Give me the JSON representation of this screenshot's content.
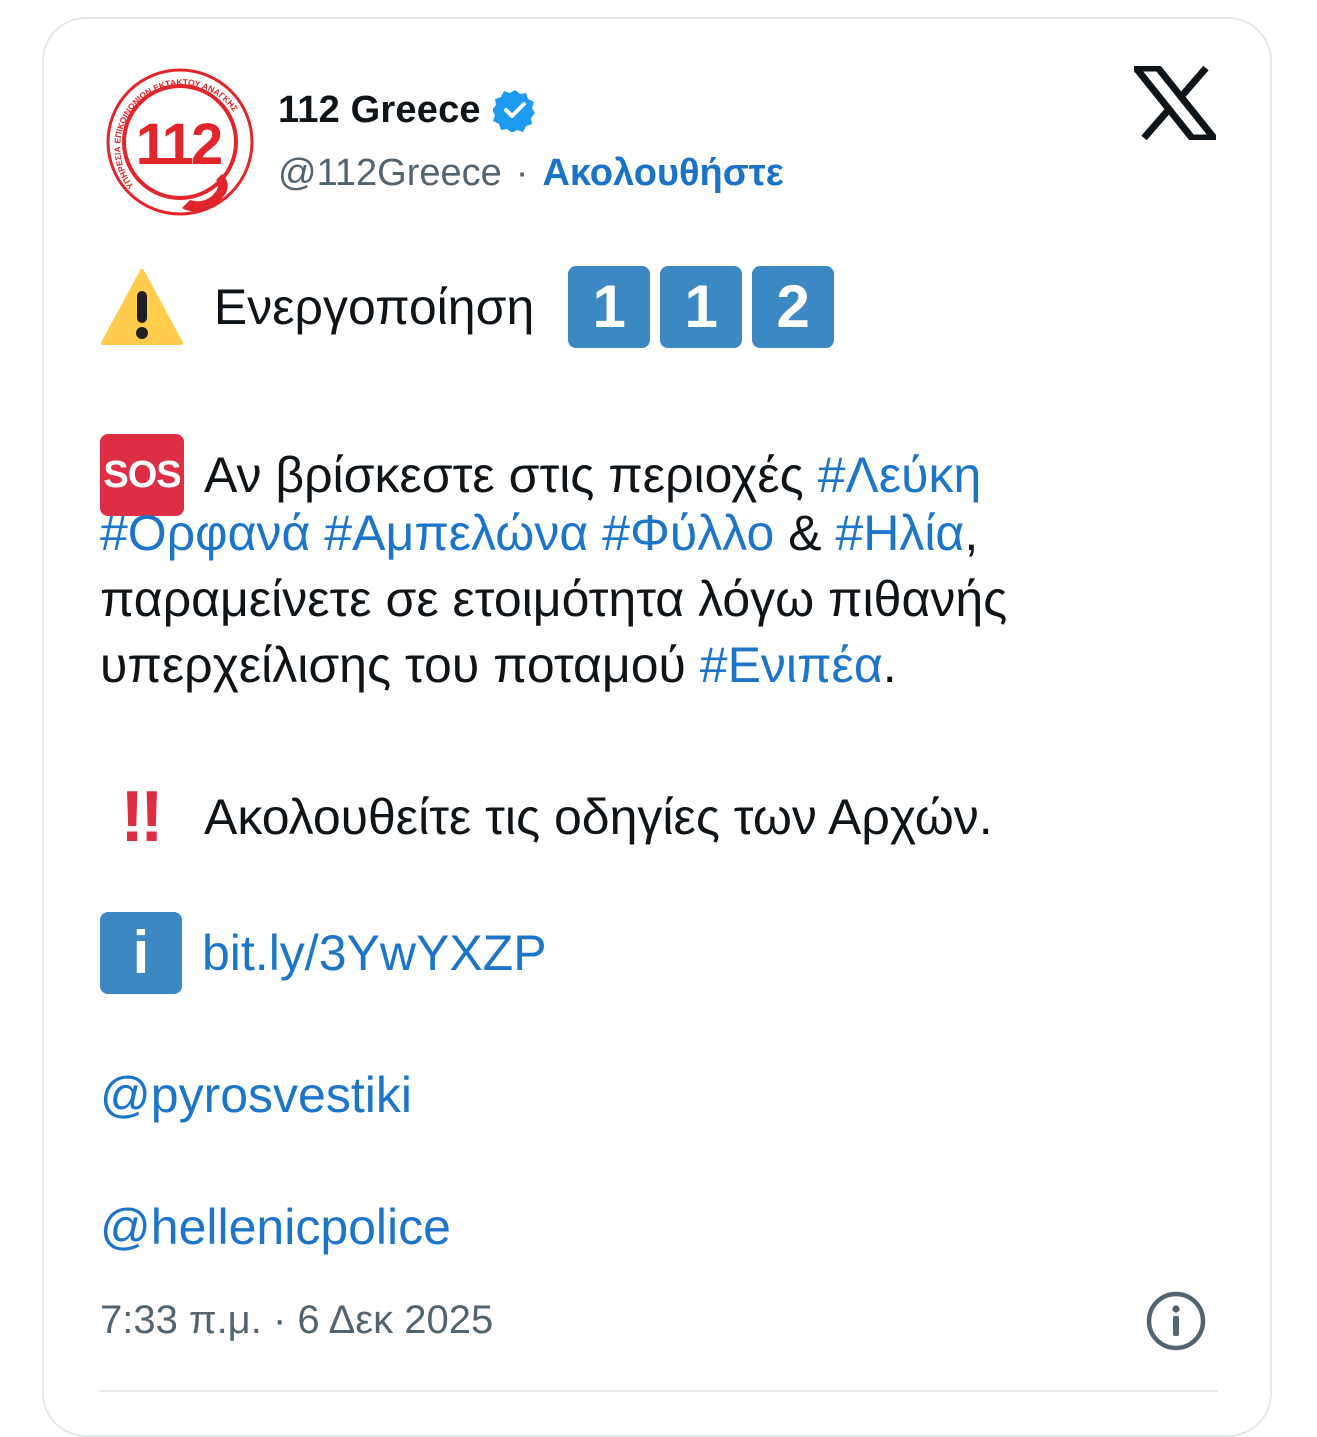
{
  "account": {
    "avatar_number": "112",
    "avatar_ring_text": "ΥΠΗΡΕΣΙΑ ΕΠΙΚΟΙΝΩΝΙΩΝ ΕΚΤΑΚΤΟΥ ΑΝΑΓΚΗΣ",
    "display_name": "112 Greece",
    "handle": "@112Greece",
    "separator": "·",
    "follow_label": "Ακολουθήστε",
    "verified_icon": "verified-badge-icon"
  },
  "tweet": {
    "line1_text": "Ενεργοποίηση",
    "line1_keycaps": [
      "1",
      "1",
      "2"
    ],
    "sos_label": "SOS",
    "para2_intro": "Αν βρίσκεστε στις περιοχές ",
    "tag_lefki": "#Λεύκη",
    "tag_orfana": "#Ορφανά",
    "tag_ampelona": "#Αμπελώνα",
    "tag_fyllo": "#Φύλλο",
    "amp": " & ",
    "tag_ilia": "#Ηλία",
    "comma": ",",
    "para2_line3": "παραμείνετε σε ετοιμότητα λόγω πιθανής",
    "para2_line4_text": "υπερχείλισης του ποταμού ",
    "tag_enipea": "#Ενιπέα",
    "period": ".",
    "bangbang": "‼",
    "para3_text": "Ακολουθείτε τις οδηγίες των Αρχών.",
    "info_glyph": "i",
    "link": "bit.ly/3YwYXZP",
    "mention1": "@pyrosvestiki",
    "mention2": "@hellenicpolice"
  },
  "footer": {
    "timestamp": "7:33 π.μ. · 6 Δεκ 2025"
  },
  "colors": {
    "link_blue": "#1d75c9",
    "keycap_blue": "#3b88c3",
    "sos_red": "#dd2e44",
    "warning_yellow": "#ffcc4d",
    "logo_red": "#e2242b"
  }
}
